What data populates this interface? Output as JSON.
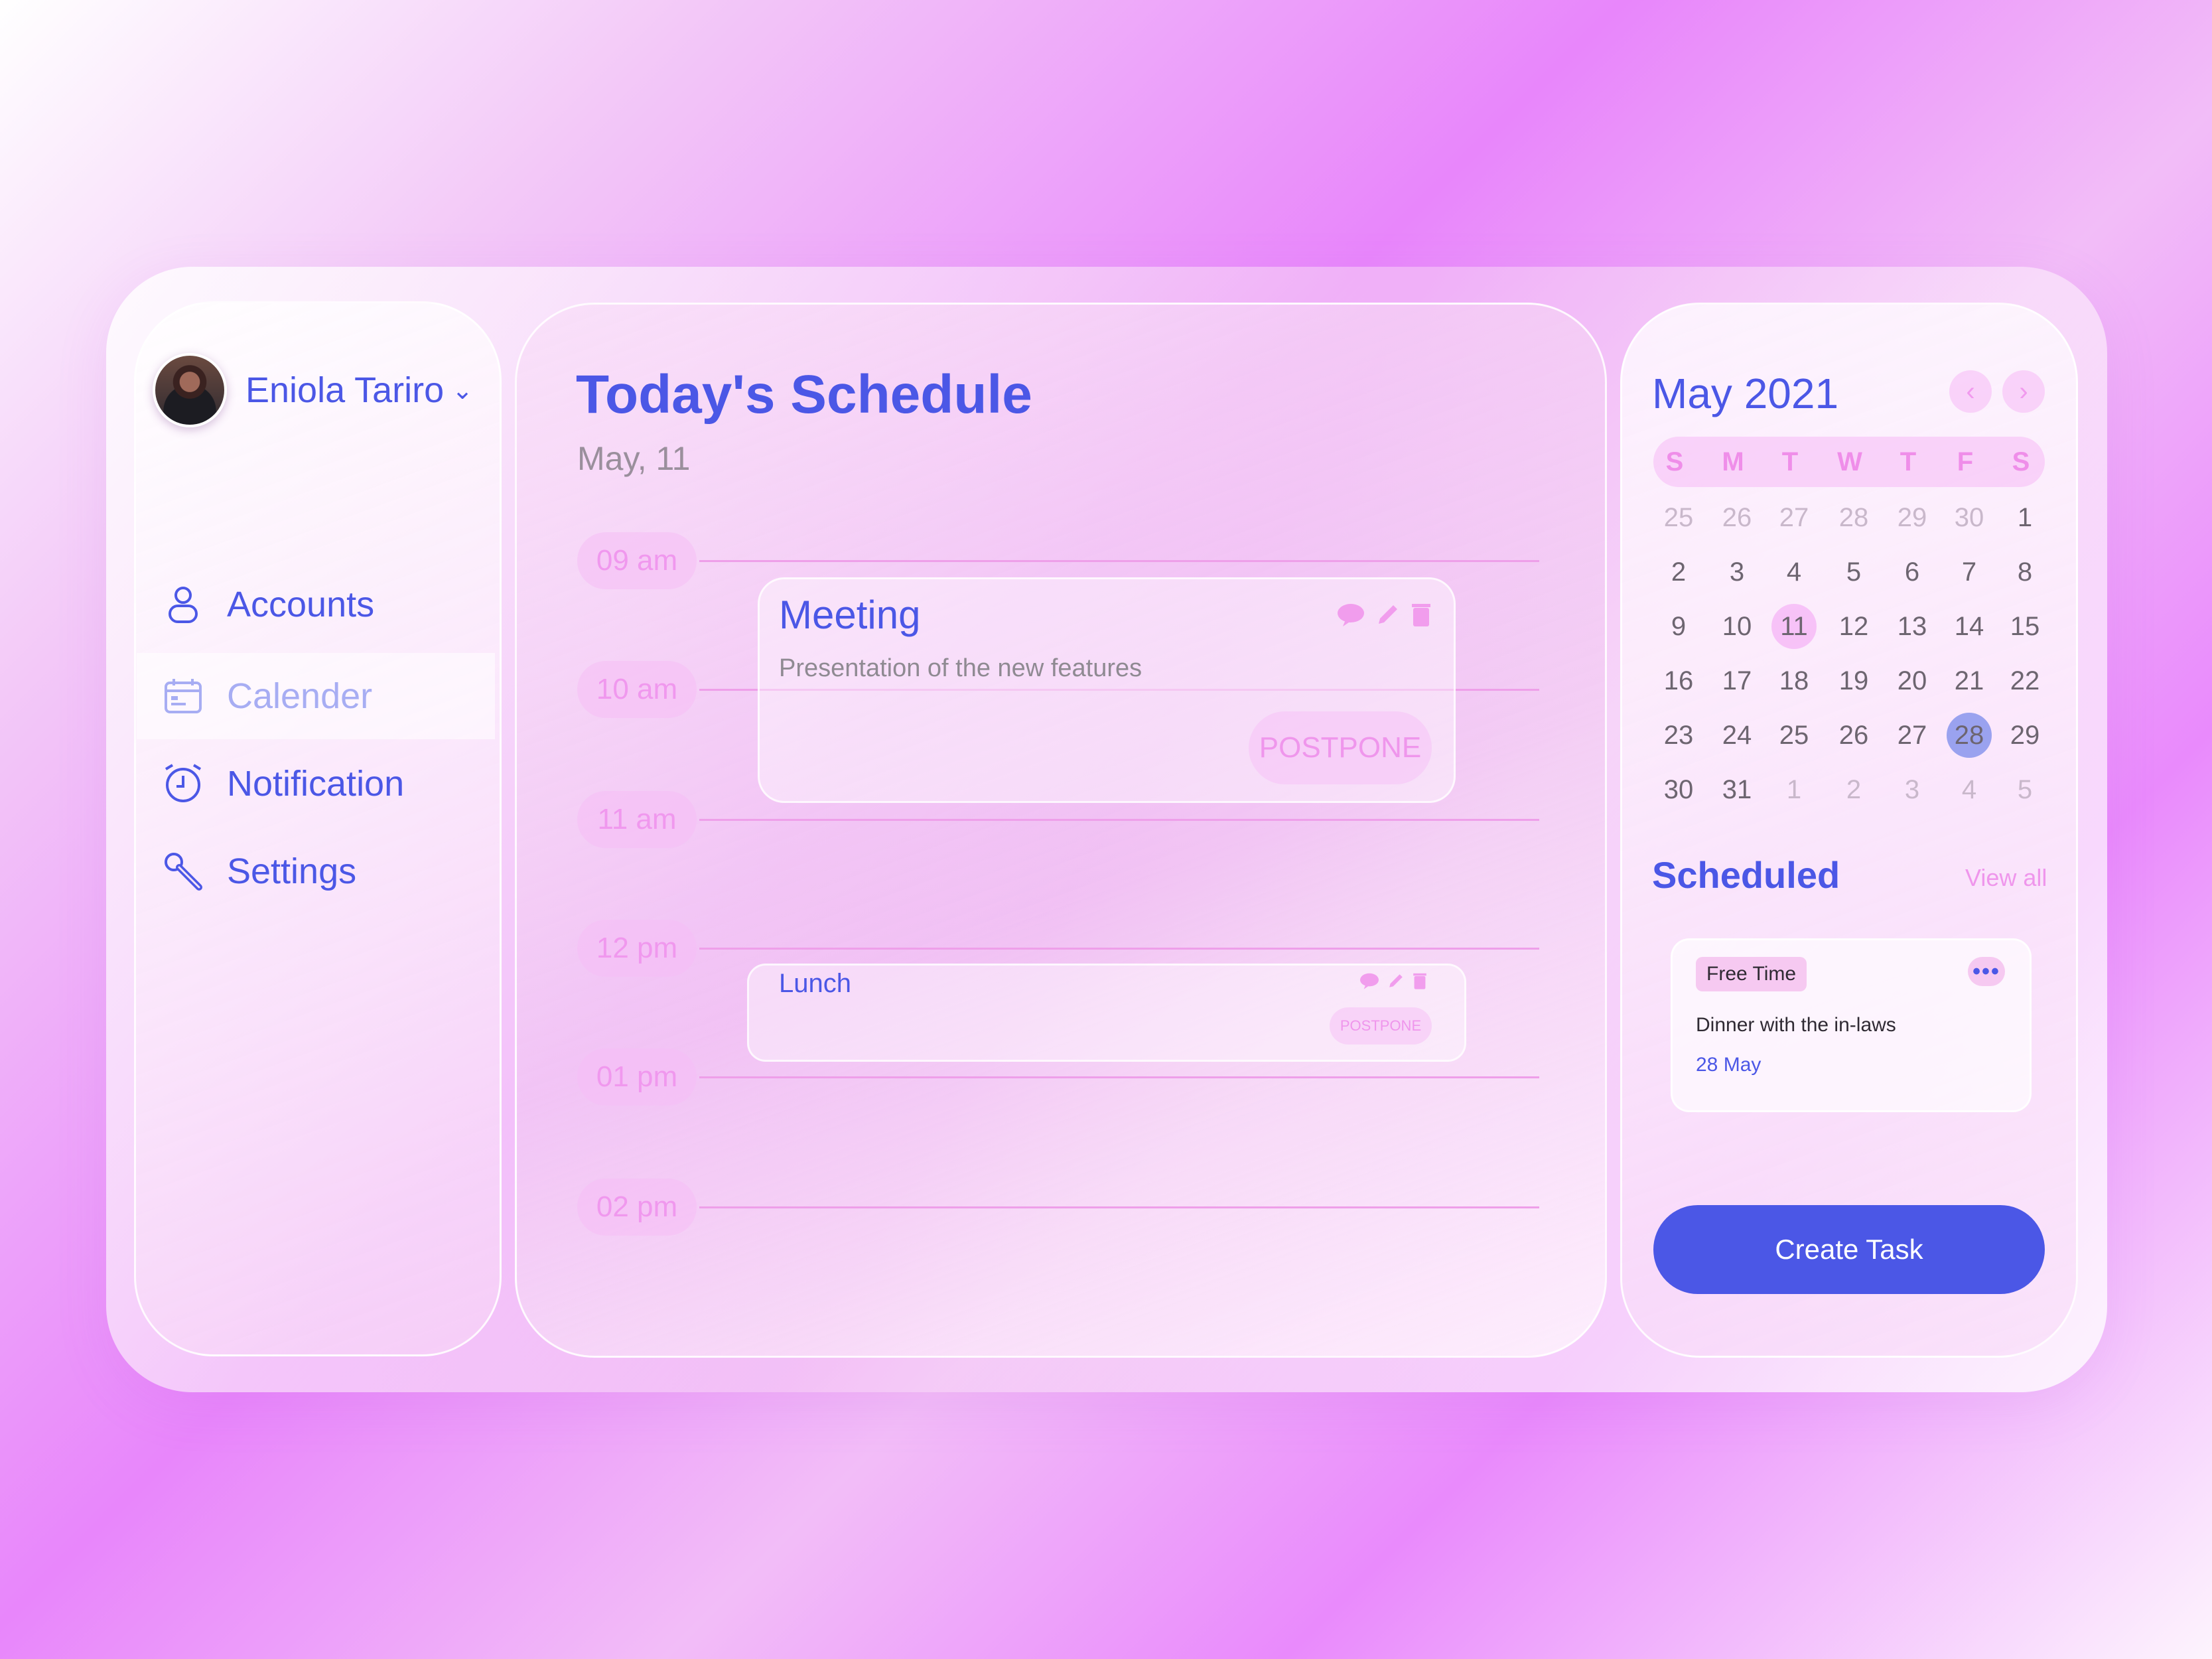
{
  "user": {
    "name": "Eniola Tariro"
  },
  "nav": {
    "items": [
      {
        "label": "Accounts",
        "icon": "user-icon"
      },
      {
        "label": "Calender",
        "icon": "calendar-icon",
        "active": true
      },
      {
        "label": "Notification",
        "icon": "alarm-clock-icon"
      },
      {
        "label": "Settings",
        "icon": "wrench-icon"
      }
    ]
  },
  "schedule": {
    "title": "Today's Schedule",
    "date": "May, 11",
    "times": [
      "09 am",
      "10 am",
      "11 am",
      "12 pm",
      "01 pm",
      "02 pm"
    ],
    "events": [
      {
        "title": "Meeting",
        "description": "Presentation of the new features",
        "action": "POSTPONE"
      },
      {
        "title": "Lunch",
        "action": "POSTPONE"
      }
    ]
  },
  "calendar": {
    "month": "May 2021",
    "weekdays": [
      "S",
      "M",
      "T",
      "W",
      "T",
      "F",
      "S"
    ],
    "weeks": [
      [
        "25",
        "26",
        "27",
        "28",
        "29",
        "30",
        "1"
      ],
      [
        "2",
        "3",
        "4",
        "5",
        "6",
        "7",
        "8"
      ],
      [
        "9",
        "10",
        "11",
        "12",
        "13",
        "14",
        "15"
      ],
      [
        "16",
        "17",
        "18",
        "19",
        "20",
        "21",
        "22"
      ],
      [
        "23",
        "24",
        "25",
        "26",
        "27",
        "28",
        "29"
      ],
      [
        "30",
        "31",
        "1",
        "2",
        "3",
        "4",
        "5"
      ]
    ],
    "today": "11",
    "selected": "28"
  },
  "scheduled": {
    "title": "Scheduled",
    "view_all": "View all",
    "items": [
      {
        "tag": "Free Time",
        "title": "Dinner with the in-laws",
        "date": "28 May"
      }
    ]
  },
  "actions": {
    "create_task": "Create Task"
  },
  "colors": {
    "accent": "#4b57e6",
    "pink": "#ef96ec",
    "background": "#e886fb"
  }
}
